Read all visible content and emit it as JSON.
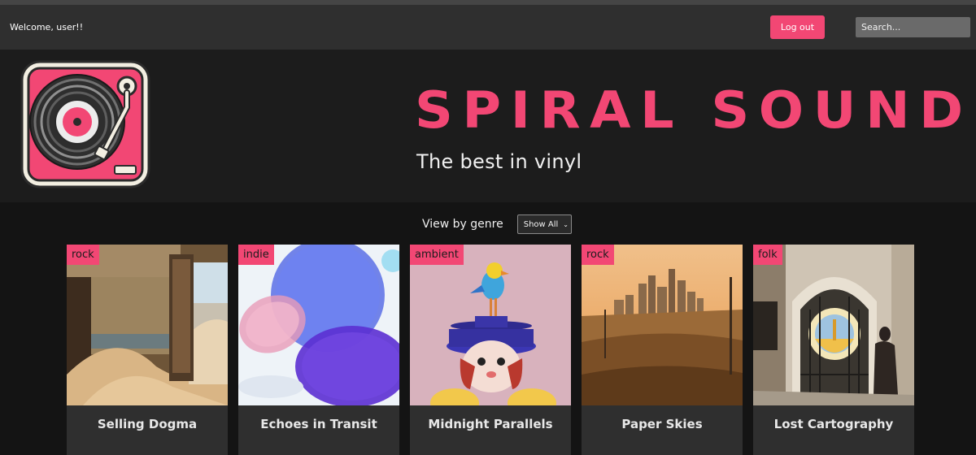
{
  "navbar": {
    "welcome": "Welcome, user!!",
    "logout_label": "Log out",
    "search_placeholder": "Search..."
  },
  "header": {
    "brand": "SPIRAL SOUNDS",
    "tagline": "The best in vinyl"
  },
  "filter": {
    "label": "View by genre",
    "selected": "Show All"
  },
  "colors": {
    "accent": "#f24774",
    "navbar": "#2f2f2f",
    "background": "#141414"
  },
  "albums": [
    {
      "genre": "rock",
      "title": "Selling Dogma",
      "art": "desert-house-icon"
    },
    {
      "genre": "indie",
      "title": "Echoes in Transit",
      "art": "glass-discs-icon"
    },
    {
      "genre": "ambient",
      "title": "Midnight Parallels",
      "art": "bird-hat-figure-icon"
    },
    {
      "genre": "rock",
      "title": "Paper Skies",
      "art": "city-sunset-icon"
    },
    {
      "genre": "folk",
      "title": "Lost Cartography",
      "art": "ornate-gate-icon"
    }
  ]
}
